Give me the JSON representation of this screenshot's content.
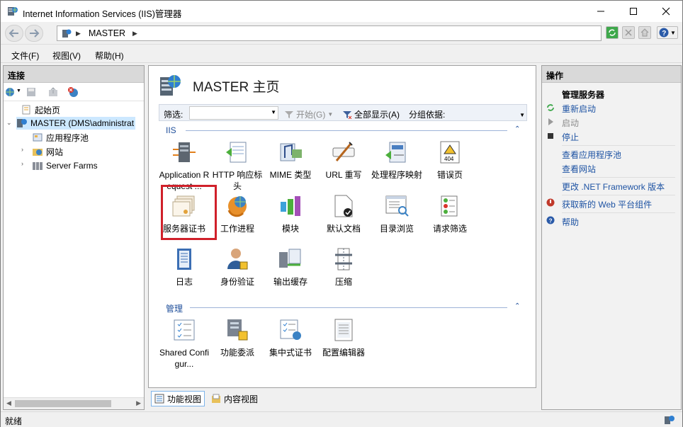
{
  "window": {
    "title": "Internet Information Services (IIS)管理器"
  },
  "address": {
    "crumb": "MASTER"
  },
  "menu": {
    "file": "文件(F)",
    "view": "视图(V)",
    "help": "帮助(H)"
  },
  "connections": {
    "header": "连接",
    "tree": [
      {
        "label": "起始页"
      },
      {
        "label": "MASTER (DMS\\administrat"
      },
      {
        "label": "应用程序池"
      },
      {
        "label": "网站"
      },
      {
        "label": "Server Farms"
      }
    ]
  },
  "center": {
    "title": "MASTER 主页",
    "filter": {
      "label": "筛选:",
      "start": "开始(G)",
      "show_all": "全部显示(A)",
      "group_by": "分组依据:"
    },
    "sections": [
      {
        "name": "IIS",
        "features": [
          "Application Request ...",
          "HTTP 响应标头",
          "MIME 类型",
          "URL 重写",
          "处理程序映射",
          "错误页",
          "服务器证书",
          "工作进程",
          "模块",
          "默认文档",
          "目录浏览",
          "请求筛选",
          "日志",
          "身份验证",
          "输出缓存",
          "压缩"
        ]
      },
      {
        "name": "管理",
        "features": [
          "Shared Configur...",
          "功能委派",
          "集中式证书",
          "配置编辑器"
        ]
      }
    ]
  },
  "view_tabs": {
    "features": "功能视图",
    "content": "内容视图"
  },
  "actions": {
    "header": "操作",
    "group_title": "管理服务器",
    "restart": "重新启动",
    "start": "启动",
    "stop": "停止",
    "view_app_pools": "查看应用程序池",
    "view_sites": "查看网站",
    "change_net": "更改 .NET Framework 版本",
    "get_web_platform": "获取新的 Web 平台组件",
    "help": "帮助"
  },
  "status": {
    "text": "就绪"
  },
  "colors": {
    "link": "#1e53a3",
    "highlight": "#d0202a",
    "selection": "#cce8ff"
  }
}
